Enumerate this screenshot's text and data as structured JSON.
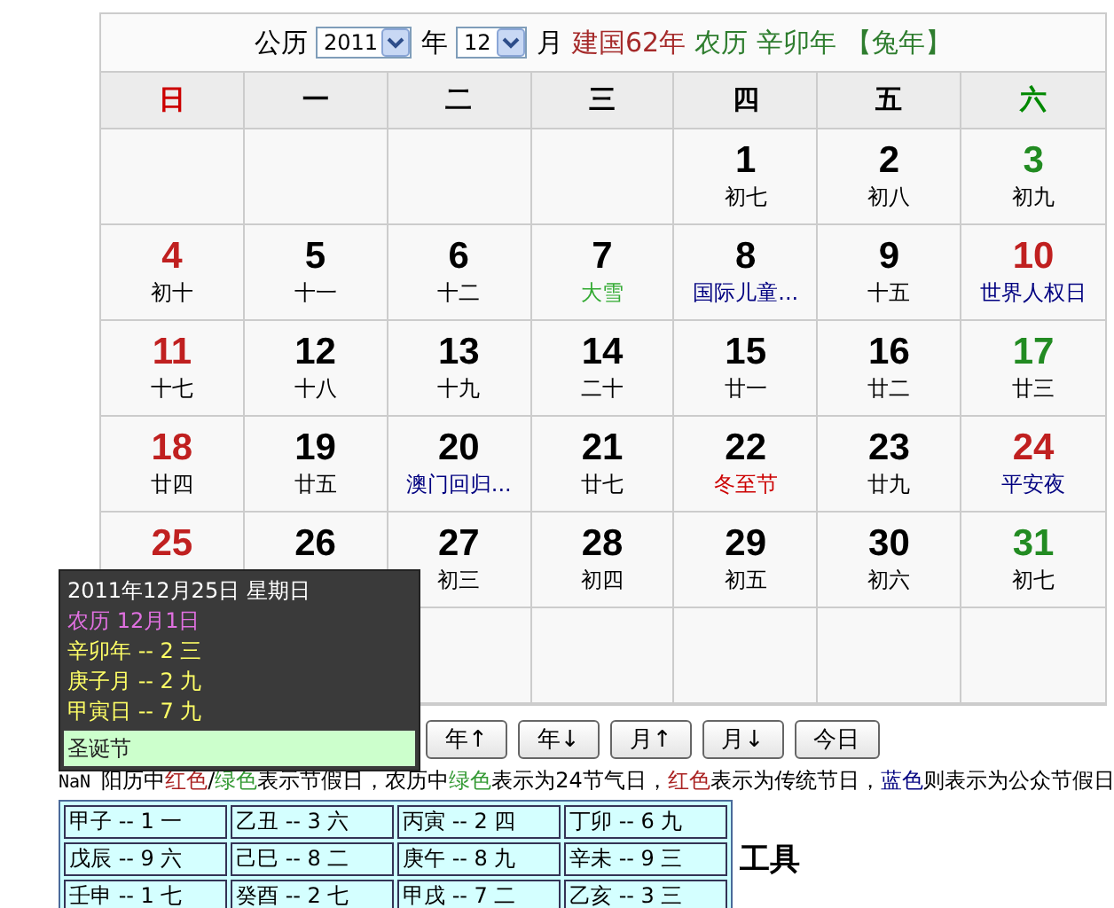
{
  "header": {
    "solar_label": "公历",
    "year_select": "2011",
    "year_label": "年",
    "month_select": "12",
    "month_label": "月",
    "national_year": "建国62年",
    "lunar_label": "农历",
    "lunar_year": "辛卯年",
    "zodiac": "【兔年】"
  },
  "weekdays": [
    {
      "label": "日",
      "color": "#cc0000"
    },
    {
      "label": "一",
      "color": "#000000"
    },
    {
      "label": "二",
      "color": "#000000"
    },
    {
      "label": "三",
      "color": "#000000"
    },
    {
      "label": "四",
      "color": "#000000"
    },
    {
      "label": "五",
      "color": "#000000"
    },
    {
      "label": "六",
      "color": "#008800"
    }
  ],
  "weeks": [
    [
      {
        "kind": "blank"
      },
      {
        "kind": "blank"
      },
      {
        "kind": "blank"
      },
      {
        "kind": "blank"
      },
      {
        "kind": "day",
        "day": "1",
        "color": "#000000",
        "note": {
          "text": "初七",
          "color": "#000000"
        }
      },
      {
        "kind": "day",
        "day": "2",
        "color": "#000000",
        "note": {
          "text": "初八",
          "color": "#000000"
        }
      },
      {
        "kind": "day",
        "day": "3",
        "color": "#228b22",
        "note": {
          "text": "初九",
          "color": "#000000"
        }
      }
    ],
    [
      {
        "kind": "day",
        "day": "4",
        "color": "#c02020",
        "note": {
          "text": "初十",
          "color": "#000000"
        }
      },
      {
        "kind": "day",
        "day": "5",
        "color": "#000000",
        "note": {
          "text": "十一",
          "color": "#000000"
        }
      },
      {
        "kind": "day",
        "day": "6",
        "color": "#000000",
        "note": {
          "text": "十二",
          "color": "#000000"
        }
      },
      {
        "kind": "day",
        "day": "7",
        "color": "#000000",
        "note": {
          "text": "大雪",
          "color": "#33aa33"
        }
      },
      {
        "kind": "day",
        "day": "8",
        "color": "#000000",
        "note": {
          "text": "国际儿童...",
          "color": "#000080"
        }
      },
      {
        "kind": "day",
        "day": "9",
        "color": "#000000",
        "note": {
          "text": "十五",
          "color": "#000000"
        }
      },
      {
        "kind": "day",
        "day": "10",
        "color": "#c02020",
        "note": {
          "text": "世界人权日",
          "color": "#000080"
        }
      }
    ],
    [
      {
        "kind": "day",
        "day": "11",
        "color": "#c02020",
        "note": {
          "text": "十七",
          "color": "#000000"
        }
      },
      {
        "kind": "day",
        "day": "12",
        "color": "#000000",
        "note": {
          "text": "十八",
          "color": "#000000"
        }
      },
      {
        "kind": "day",
        "day": "13",
        "color": "#000000",
        "note": {
          "text": "十九",
          "color": "#000000"
        }
      },
      {
        "kind": "day",
        "day": "14",
        "color": "#000000",
        "note": {
          "text": "二十",
          "color": "#000000"
        }
      },
      {
        "kind": "day",
        "day": "15",
        "color": "#000000",
        "note": {
          "text": "廿一",
          "color": "#000000"
        }
      },
      {
        "kind": "day",
        "day": "16",
        "color": "#000000",
        "note": {
          "text": "廿二",
          "color": "#000000"
        }
      },
      {
        "kind": "day",
        "day": "17",
        "color": "#228b22",
        "note": {
          "text": "廿三",
          "color": "#000000"
        }
      }
    ],
    [
      {
        "kind": "day",
        "day": "18",
        "color": "#c02020",
        "note": {
          "text": "廿四",
          "color": "#000000"
        }
      },
      {
        "kind": "day",
        "day": "19",
        "color": "#000000",
        "note": {
          "text": "廿五",
          "color": "#000000"
        }
      },
      {
        "kind": "day",
        "day": "20",
        "color": "#000000",
        "note": {
          "text": "澳门回归...",
          "color": "#000080"
        }
      },
      {
        "kind": "day",
        "day": "21",
        "color": "#000000",
        "note": {
          "text": "廿七",
          "color": "#000000"
        }
      },
      {
        "kind": "day",
        "day": "22",
        "color": "#000000",
        "note": {
          "text": "冬至节",
          "color": "#cc0000"
        }
      },
      {
        "kind": "day",
        "day": "23",
        "color": "#000000",
        "note": {
          "text": "廿九",
          "color": "#000000"
        }
      },
      {
        "kind": "day",
        "day": "24",
        "color": "#c02020",
        "note": {
          "text": "平安夜",
          "color": "#000080"
        }
      }
    ],
    [
      {
        "kind": "day",
        "day": "25",
        "color": "#c02020"
      },
      {
        "kind": "day",
        "day": "26",
        "color": "#000000"
      },
      {
        "kind": "day",
        "day": "27",
        "color": "#000000",
        "note": {
          "text": "初三",
          "color": "#000000"
        }
      },
      {
        "kind": "day",
        "day": "28",
        "color": "#000000",
        "note": {
          "text": "初四",
          "color": "#000000"
        }
      },
      {
        "kind": "day",
        "day": "29",
        "color": "#000000",
        "note": {
          "text": "初五",
          "color": "#000000"
        }
      },
      {
        "kind": "day",
        "day": "30",
        "color": "#000000",
        "note": {
          "text": "初六",
          "color": "#000000"
        }
      },
      {
        "kind": "day",
        "day": "31",
        "color": "#228b22",
        "note": {
          "text": "初七",
          "color": "#000000"
        }
      }
    ],
    [
      {
        "kind": "blank"
      },
      {
        "kind": "blank"
      },
      {
        "kind": "blank"
      },
      {
        "kind": "blank"
      },
      {
        "kind": "blank"
      },
      {
        "kind": "blank"
      },
      {
        "kind": "blank"
      }
    ]
  ],
  "tooltip": {
    "date": "2011年12月25日 星期日",
    "lunar_date": "农历 12月1日",
    "ganzhi": [
      "辛卯年 -- 2 三",
      "庚子月 -- 2 九",
      "甲寅日 -- 7 九"
    ],
    "festival": "圣诞节"
  },
  "buttons": [
    "年↑",
    "年↓",
    "月↑",
    "月↓",
    "今日"
  ],
  "legend": [
    {
      "text": "NaN ",
      "color": "#000000",
      "kind": "mono"
    },
    {
      "text": "阳历中",
      "color": "#000000"
    },
    {
      "text": "红色",
      "color": "#aa2222"
    },
    {
      "text": "/",
      "color": "#000000"
    },
    {
      "text": "绿色",
      "color": "#339933"
    },
    {
      "text": "表示节假日，农历中",
      "color": "#000000"
    },
    {
      "text": "绿色",
      "color": "#339933"
    },
    {
      "text": "表示为24节气日，",
      "color": "#000000"
    },
    {
      "text": "红色",
      "color": "#aa2222"
    },
    {
      "text": "表示为传统节日，",
      "color": "#000000"
    },
    {
      "text": "蓝色",
      "color": "#000080"
    },
    {
      "text": "则表示为公众节假日",
      "color": "#000000"
    }
  ],
  "ganzhi_table": [
    [
      "甲子 -- 1 一",
      "乙丑 -- 3 六",
      "丙寅 -- 2 四",
      "丁卯 -- 6 九"
    ],
    [
      "戊辰 -- 9 六",
      "己巳 -- 8 二",
      "庚午 -- 8 九",
      "辛未 -- 9 三"
    ],
    [
      "壬申 -- 1 七",
      "癸酉 -- 2 七",
      "甲戌 -- 7 二",
      "乙亥 -- 3 三"
    ]
  ],
  "section_heading": "工具"
}
